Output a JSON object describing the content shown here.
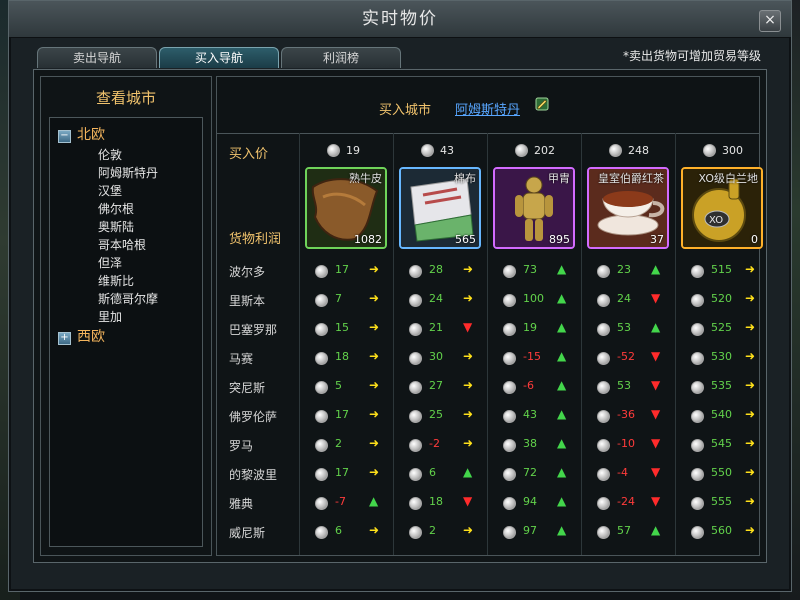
{
  "window": {
    "title": "实时物价",
    "close_label": "×"
  },
  "tabs": [
    {
      "label": "卖出导航",
      "active": false
    },
    {
      "label": "买入导航",
      "active": true
    },
    {
      "label": "利润榜",
      "active": false
    }
  ],
  "note": "*卖出货物可增加贸易等级",
  "sidebar": {
    "title": "查看城市",
    "groups": [
      {
        "name": "北欧",
        "expanded": true,
        "toggle_label": "−",
        "cities": [
          "伦敦",
          "阿姆斯特丹",
          "汉堡",
          "佛尔根",
          "奥斯陆",
          "哥本哈根",
          "但泽",
          "维斯比",
          "斯德哥尔摩",
          "里加"
        ]
      },
      {
        "name": "西欧",
        "expanded": false,
        "toggle_label": "+",
        "cities": []
      }
    ]
  },
  "main": {
    "buy_city_label": "买入城市",
    "buy_city_name": "阿姆斯特丹",
    "buy_price_label": "买入价",
    "profit_label": "货物利润",
    "goods": [
      {
        "name": "熟牛皮",
        "buy_price": "19",
        "qty": "1082",
        "border": "#6fd45a",
        "art": "leather"
      },
      {
        "name": "棉布",
        "buy_price": "43",
        "qty": "565",
        "border": "#67b7ff",
        "art": "cloth"
      },
      {
        "name": "甲胄",
        "buy_price": "202",
        "qty": "895",
        "border": "#d36bff",
        "art": "armor"
      },
      {
        "name": "皇室伯爵红茶",
        "buy_price": "248",
        "qty": "37",
        "border": "#d36bff",
        "art": "tea"
      },
      {
        "name": "XO级白兰地",
        "buy_price": "300",
        "qty": "0",
        "border": "#ffb12a",
        "art": "brandy"
      }
    ],
    "cities": [
      {
        "name": "波尔多",
        "profits": [
          {
            "value": "17",
            "trend": "flat"
          },
          {
            "value": "28",
            "trend": "flat"
          },
          {
            "value": "73",
            "trend": "up"
          },
          {
            "value": "23",
            "trend": "up"
          },
          {
            "value": "515",
            "trend": "flat"
          }
        ]
      },
      {
        "name": "里斯本",
        "profits": [
          {
            "value": "7",
            "trend": "flat"
          },
          {
            "value": "24",
            "trend": "flat"
          },
          {
            "value": "100",
            "trend": "up"
          },
          {
            "value": "24",
            "trend": "down"
          },
          {
            "value": "520",
            "trend": "flat"
          }
        ]
      },
      {
        "name": "巴塞罗那",
        "profits": [
          {
            "value": "15",
            "trend": "flat"
          },
          {
            "value": "21",
            "trend": "down"
          },
          {
            "value": "19",
            "trend": "up"
          },
          {
            "value": "53",
            "trend": "up"
          },
          {
            "value": "525",
            "trend": "flat"
          }
        ]
      },
      {
        "name": "马赛",
        "profits": [
          {
            "value": "18",
            "trend": "flat"
          },
          {
            "value": "30",
            "trend": "flat"
          },
          {
            "value": "-15",
            "trend": "up"
          },
          {
            "value": "-52",
            "trend": "down"
          },
          {
            "value": "530",
            "trend": "flat"
          }
        ]
      },
      {
        "name": "突尼斯",
        "profits": [
          {
            "value": "5",
            "trend": "flat"
          },
          {
            "value": "27",
            "trend": "flat"
          },
          {
            "value": "-6",
            "trend": "up"
          },
          {
            "value": "53",
            "trend": "down"
          },
          {
            "value": "535",
            "trend": "flat"
          }
        ]
      },
      {
        "name": "佛罗伦萨",
        "profits": [
          {
            "value": "17",
            "trend": "flat"
          },
          {
            "value": "25",
            "trend": "flat"
          },
          {
            "value": "43",
            "trend": "up"
          },
          {
            "value": "-36",
            "trend": "down"
          },
          {
            "value": "540",
            "trend": "flat"
          }
        ]
      },
      {
        "name": "罗马",
        "profits": [
          {
            "value": "2",
            "trend": "flat"
          },
          {
            "value": "-2",
            "trend": "flat"
          },
          {
            "value": "38",
            "trend": "up"
          },
          {
            "value": "-10",
            "trend": "down"
          },
          {
            "value": "545",
            "trend": "flat"
          }
        ]
      },
      {
        "name": "的黎波里",
        "profits": [
          {
            "value": "17",
            "trend": "flat"
          },
          {
            "value": "6",
            "trend": "up"
          },
          {
            "value": "72",
            "trend": "up"
          },
          {
            "value": "-4",
            "trend": "down"
          },
          {
            "value": "550",
            "trend": "flat"
          }
        ]
      },
      {
        "name": "雅典",
        "profits": [
          {
            "value": "-7",
            "trend": "up"
          },
          {
            "value": "18",
            "trend": "down"
          },
          {
            "value": "94",
            "trend": "up"
          },
          {
            "value": "-24",
            "trend": "down"
          },
          {
            "value": "555",
            "trend": "flat"
          }
        ]
      },
      {
        "name": "威尼斯",
        "profits": [
          {
            "value": "6",
            "trend": "flat"
          },
          {
            "value": "2",
            "trend": "flat"
          },
          {
            "value": "97",
            "trend": "up"
          },
          {
            "value": "57",
            "trend": "up"
          },
          {
            "value": "560",
            "trend": "flat"
          }
        ]
      }
    ]
  },
  "icons": {
    "coin": "silver-coin-icon",
    "edit": "edit-location-icon",
    "trend_up": "trend-up-arrow-icon",
    "trend_down": "trend-down-arrow-icon",
    "trend_flat": "trend-flat-arrow-icon",
    "tree_expand": "expand-plus-icon",
    "tree_collapse": "collapse-minus-icon"
  },
  "colors": {
    "accent_gold": "#f1c36d",
    "link_blue": "#58a6ff",
    "profit_positive": "#62d24b",
    "profit_negative": "#ff3b3b",
    "trend_flat": "#ffe11a"
  }
}
